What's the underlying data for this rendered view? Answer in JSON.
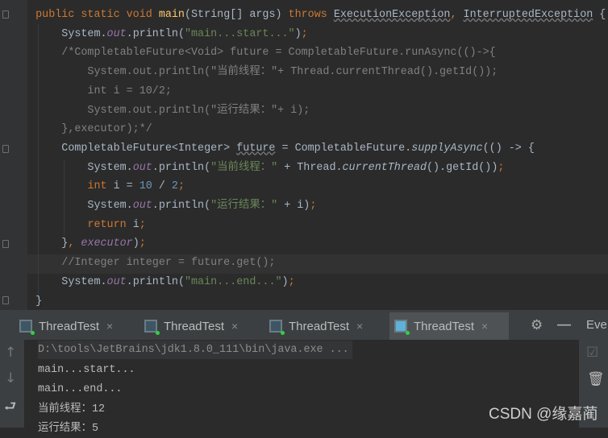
{
  "editor": {
    "lines": [
      [
        [
          "    public static void ",
          "kw"
        ],
        [
          "main",
          "fn"
        ],
        [
          "(String[] args) ",
          ""
        ],
        [
          "throws ",
          "kw"
        ],
        [
          "ExecutionException",
          "wavy"
        ],
        [
          ", ",
          "kw"
        ],
        [
          "InterruptedException",
          "wavy"
        ],
        [
          " {",
          ""
        ]
      ],
      [
        [
          "        System.",
          ""
        ],
        [
          "out",
          "fld"
        ],
        [
          ".println(",
          ""
        ],
        [
          "\"main...start...\"",
          "str"
        ],
        [
          ")",
          ""
        ],
        [
          ";",
          "kw"
        ]
      ],
      [
        [
          "        /*CompletableFuture<Void> future = CompletableFuture.runAsync(()->{",
          "cm"
        ]
      ],
      [
        [
          "            System.out.println(\"当前线程：\"+ Thread.currentThread().getId());",
          "cm"
        ]
      ],
      [
        [
          "            int i = 10/2;",
          "cm"
        ]
      ],
      [
        [
          "            System.out.println(\"运行结果：\"+ i);",
          "cm"
        ]
      ],
      [
        [
          "        },executor);*/",
          "cm"
        ]
      ],
      [
        [
          "        CompletableFuture<Integer> ",
          ""
        ],
        [
          "future",
          "wavy"
        ],
        [
          " = CompletableFuture.",
          ""
        ],
        [
          "supplyAsync",
          "it"
        ],
        [
          "(() -> {",
          ""
        ]
      ],
      [
        [
          "            System.",
          ""
        ],
        [
          "out",
          "fld"
        ],
        [
          ".println(",
          ""
        ],
        [
          "\"当前线程：\"",
          "str"
        ],
        [
          " + Thread.",
          ""
        ],
        [
          "currentThread",
          "it"
        ],
        [
          "().getId())",
          ""
        ],
        [
          ";",
          "kw"
        ]
      ],
      [
        [
          "            ",
          ""
        ],
        [
          "int",
          "kw"
        ],
        [
          " i = ",
          ""
        ],
        [
          "10",
          "num"
        ],
        [
          " / ",
          ""
        ],
        [
          "2",
          "num"
        ],
        [
          ";",
          "kw"
        ]
      ],
      [
        [
          "            System.",
          ""
        ],
        [
          "out",
          "fld"
        ],
        [
          ".println(",
          ""
        ],
        [
          "\"运行结果：\"",
          "str"
        ],
        [
          " + i)",
          ""
        ],
        [
          ";",
          "kw"
        ]
      ],
      [
        [
          "            ",
          ""
        ],
        [
          "return",
          "kw"
        ],
        [
          " i",
          ""
        ],
        [
          ";",
          "kw"
        ]
      ],
      [
        [
          "        }",
          ""
        ],
        [
          ", ",
          "kw"
        ],
        [
          "executor",
          "fld"
        ],
        [
          ")",
          ""
        ],
        [
          ";",
          "kw"
        ]
      ],
      [
        [
          "        //Integer integer = future.get();",
          "cm"
        ]
      ],
      [
        [
          "        System.",
          ""
        ],
        [
          "out",
          "fld"
        ],
        [
          ".println(",
          ""
        ],
        [
          "\"main...end...\"",
          "str"
        ],
        [
          ")",
          ""
        ],
        [
          ";",
          "kw"
        ]
      ],
      [
        [
          "    }",
          ""
        ]
      ]
    ]
  },
  "run_tabs": [
    {
      "label": "ThreadTest",
      "close": "×"
    },
    {
      "label": "ThreadTest",
      "close": "×"
    },
    {
      "label": "ThreadTest",
      "close": "×"
    },
    {
      "label": "ThreadTest",
      "close": "×",
      "active": true
    }
  ],
  "toolbar": {
    "settings_icon": "⚙",
    "hide_icon": "—",
    "event_log_label": "Eve"
  },
  "console": {
    "lines": [
      "D:\\tools\\JetBrains\\jdk1.8.0_111\\bin\\java.exe ...",
      "main...start...",
      "main...end...",
      "当前线程：12",
      "运行结果：5"
    ]
  },
  "watermark": "CSDN @缘嘉蔺"
}
